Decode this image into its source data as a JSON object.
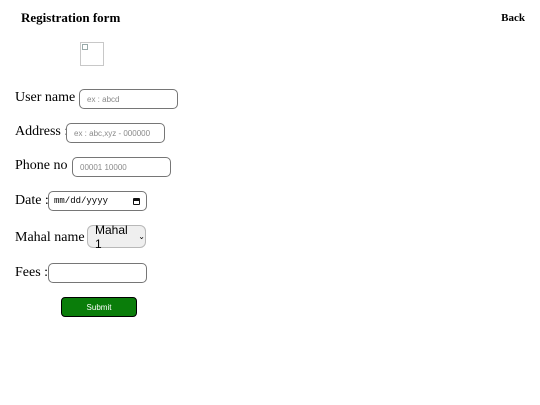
{
  "header": {
    "title": "Registration form",
    "back_label": "Back"
  },
  "form": {
    "username": {
      "label": "User name :",
      "placeholder": "ex : abcd"
    },
    "address": {
      "label": "Address :",
      "placeholder": "ex : abc,xyz - 000000"
    },
    "phone": {
      "label": "Phone no :",
      "placeholder": "00001 10000"
    },
    "date": {
      "label": "Date :",
      "value": "mm/dd/yyyy"
    },
    "mahal": {
      "label": "Mahal name :",
      "selected": "Mahal 1"
    },
    "fees": {
      "label": "Fees :",
      "value": ""
    },
    "submit_label": "Submit"
  },
  "colors": {
    "submit_bg": "#0a7d0a"
  }
}
